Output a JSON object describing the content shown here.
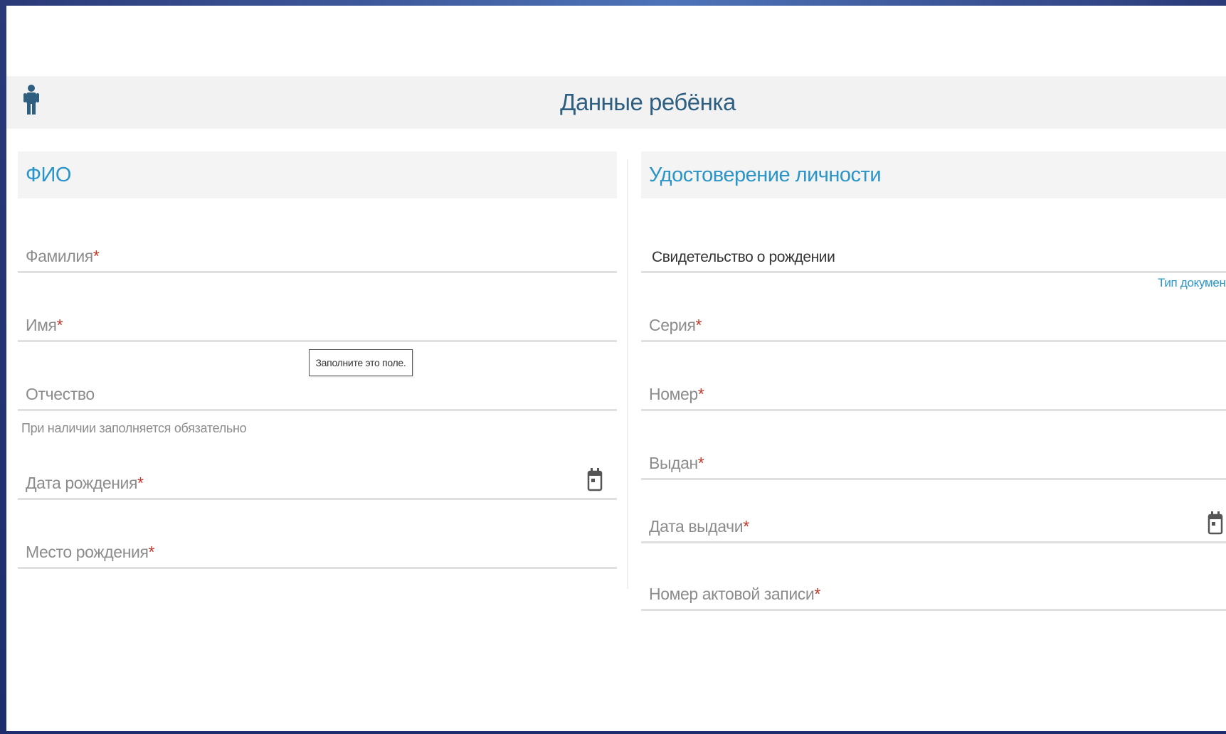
{
  "header": {
    "title": "Данные ребёнка",
    "icon": "person-icon"
  },
  "left_section": {
    "title": "ФИО",
    "fields": {
      "last_name": {
        "label": "Фамилия",
        "required_mark": "*"
      },
      "first_name": {
        "label": "Имя",
        "required_mark": "*"
      },
      "middle_name": {
        "label": "Отчество",
        "hint": "При наличии заполняется обязательно"
      },
      "birth_date": {
        "label": "Дата рождения",
        "required_mark": "*",
        "icon": "calendar-icon"
      },
      "birth_place": {
        "label": "Место рождения",
        "required_mark": "*"
      }
    },
    "tooltip": "Заполните это поле."
  },
  "right_section": {
    "title": "Удостоверение личности",
    "fields": {
      "doc_type": {
        "value": "Свидетельство о рождении",
        "hint": "Тип документ"
      },
      "series": {
        "label": "Серия",
        "required_mark": "*"
      },
      "number": {
        "label": "Номер",
        "required_mark": "*"
      },
      "issued_by": {
        "label": "Выдан",
        "required_mark": "*"
      },
      "issue_date": {
        "label": "Дата выдачи",
        "required_mark": "*",
        "icon": "calendar-icon"
      },
      "act_record_number": {
        "label": "Номер актовой записи",
        "required_mark": "*"
      }
    }
  },
  "colors": {
    "frame": "#2a3d82",
    "title_text": "#2e5f80",
    "section_accent": "#2b95c8",
    "required": "#c0392b",
    "label": "#8c8c8c",
    "underline": "#e0e0e0"
  }
}
